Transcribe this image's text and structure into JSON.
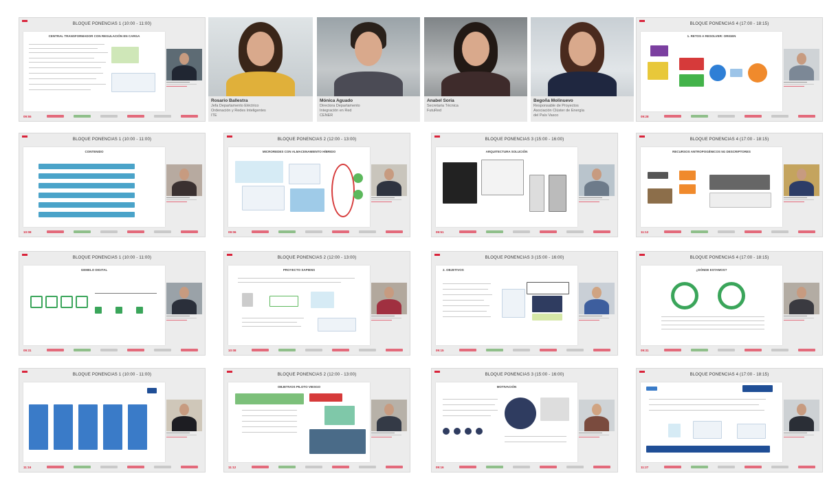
{
  "app": {
    "title": ""
  },
  "cards": [
    {
      "id": "c1",
      "title": "BLOQUE PONENCIAS 1 (10:00 - 11:00)",
      "slide_title": "CENTRAL TRANSFORMADOR CON REGULACIÓN EN CARGA",
      "time": "09:55"
    },
    {
      "id": "c6",
      "title": "BLOQUE PONENCIAS 4 (17:00 - 18:15)",
      "slide_title": "1. RETOS A RESOLVER: ORIGEN",
      "time": "09:28"
    },
    {
      "id": "c7",
      "title": "BLOQUE PONENCIAS 1 (10:00 - 11:00)",
      "slide_title": "CONTENIDO",
      "time": "10:08"
    },
    {
      "id": "c8",
      "title": "BLOQUE PONENCIAS 2 (12:00 - 13:00)",
      "slide_title": "MICROREDES CON ALMACENAMIENTO HÍBRIDO",
      "time": "09:06"
    },
    {
      "id": "c9",
      "title": "BLOQUE PONENCIAS 3 (15:00 - 16:00)",
      "slide_title": "ARQUITECTURA SOLUCIÓN",
      "time": "09:51"
    },
    {
      "id": "c10",
      "title": "BLOQUE PONENCIAS 4 (17:00 - 18:15)",
      "slide_title": "RECURSOS ANTROPOGÉNICOS 5G DESCRIPTORES",
      "time": "11:12"
    },
    {
      "id": "c11",
      "title": "BLOQUE PONENCIAS 1 (10:00 - 11:00)",
      "slide_title": "GEMELO DIGITAL",
      "time": "09:31"
    },
    {
      "id": "c12",
      "title": "BLOQUE PONENCIAS 2 (12:00 - 13:00)",
      "slide_title": "PROYECTO SAPIENS",
      "time": "10:08"
    },
    {
      "id": "c13",
      "title": "BLOQUE PONENCIAS 3 (15:00 - 16:00)",
      "slide_title": "2. OBJETIVOS",
      "time": "09:15"
    },
    {
      "id": "c14",
      "title": "BLOQUE PONENCIAS 4 (17:00 - 18:15)",
      "slide_title": "¿DÓNDE ESTAMOS?",
      "time": "09:31"
    },
    {
      "id": "c15",
      "title": "BLOQUE PONENCIAS 1 (10:00 - 11:00)",
      "slide_title": "",
      "time": "11:16"
    },
    {
      "id": "c16",
      "title": "BLOQUE PONENCIAS 2 (12:00 - 13:00)",
      "slide_title": "OBJETIVOS PILOTO VIESGO",
      "time": "11:12"
    },
    {
      "id": "c17",
      "title": "BLOQUE PONENCIAS 3 (15:00 - 16:00)",
      "slide_title": "MOTIVACIÓN",
      "time": "09:16"
    },
    {
      "id": "c18",
      "title": "BLOQUE PONENCIAS 4 (17:00 - 18:15)",
      "slide_title": "",
      "time": "11:27"
    }
  ],
  "speakers": [
    {
      "name": "Rosario Ballestra",
      "role1": "Jefa Departamento Eléctrico",
      "role2": "Ordenación y Redes Inteligentes",
      "org": "ITE"
    },
    {
      "name": "Mónica Aguado",
      "role1": "Directora Departamento",
      "role2": "Integración en Red",
      "org": "CENER"
    },
    {
      "name": "Anabel Soria",
      "role1": "Secretaria Técnica",
      "role2": "",
      "org": "FutuRed"
    },
    {
      "name": "Begoña Molinuevo",
      "role1": "Responsable de Proyectos",
      "role2": "Asociación Clúster de Energía",
      "org": "del País Vasco"
    }
  ],
  "colors": {
    "accent": "#d9233a",
    "card_bg": "#ececec",
    "slide_bg": "#ffffff"
  }
}
